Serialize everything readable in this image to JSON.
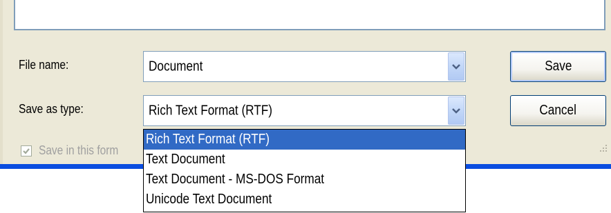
{
  "save_dialog": {
    "file_name_label": "File name:",
    "file_name_value": "Document",
    "save_as_type_label": "Save as type:",
    "save_as_type_value": "Rich Text Format (RTF)",
    "save_button": "Save",
    "cancel_button": "Cancel",
    "save_in_format_label": "Save in this form",
    "save_in_format_checked": true
  },
  "type_dropdown": {
    "options": [
      "Rich Text Format (RTF)",
      "Text Document",
      "Text Document - MS-DOS Format",
      "Unicode Text Document"
    ],
    "selected_index": 0
  },
  "colors": {
    "dialog_background": "#ece9d8",
    "selection_highlight": "#316ac5",
    "taskbar_blue": "#0a4de0",
    "field_border": "#7f9db9"
  }
}
